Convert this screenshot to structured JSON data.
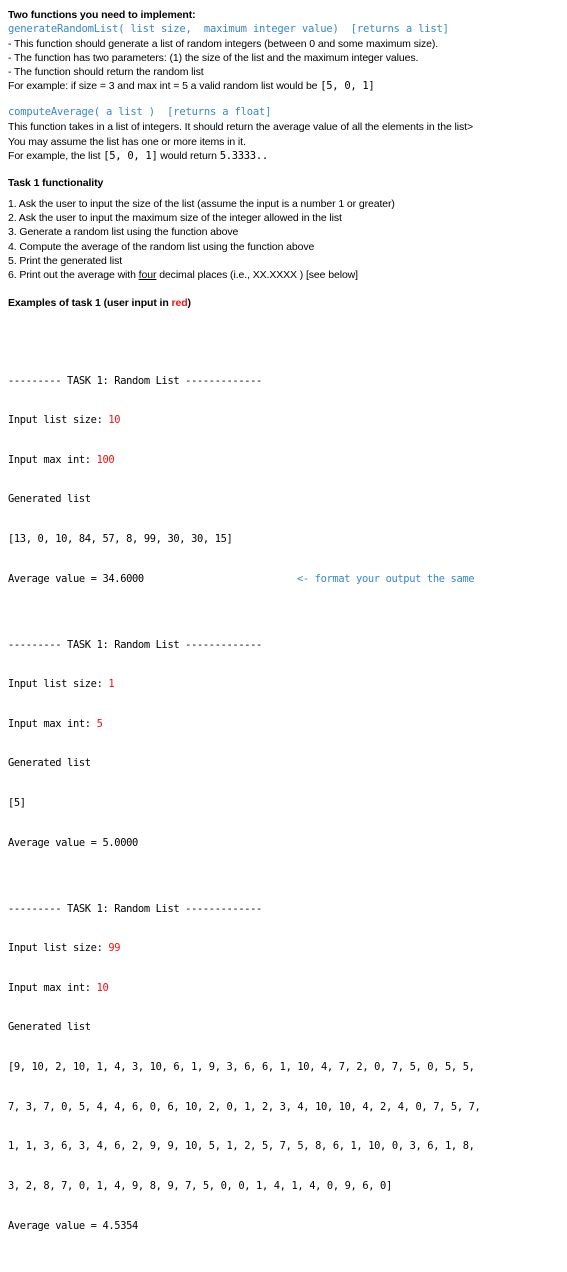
{
  "document": {
    "intro_heading": "Two functions you need to implement:",
    "functions": [
      {
        "signature": "generateRandomList( list size,  maximum integer value)  [returns a list]",
        "bullets": [
          "- This function should generate a list of random integers (between 0 and some maximum size).",
          "- The function has two parameters: (1) the size of the list and the maximum integer values.",
          "- The function should return the random list"
        ],
        "example_prefix": "For example: if size = 3 and max int = 5 a valid random list would be ",
        "example_mono": "[5, 0, 1]",
        "example_suffix": ""
      },
      {
        "signature": "computeAverage( a list )  [returns a float]",
        "bullets": [
          "This function takes in a list of integers.  It should return the average value of all the elements in the list>",
          "You may assume the list has one or more items in it."
        ],
        "example_prefix": "For example, the list ",
        "example_mono": "[5, 0, 1]",
        "example_suffix": " would return ",
        "example_mono2": "5.3333.."
      }
    ],
    "task_heading": "Task 1 functionality",
    "task_steps": [
      "1. Ask the user to input the size of the list (assume the input is a number 1 or greater)",
      "2. Ask the user to input the maximum size of the integer allowed in the list",
      "3. Generate a random list using the function above",
      "4. Compute the average of the random list using the function above",
      "5. Print the generated list"
    ],
    "task_step_6": {
      "before": "6. Print out the average with ",
      "underlined": "four",
      "after": " decimal places (i.e., XX.XXXX )  [see below]"
    },
    "examples_heading": {
      "before": "Examples of task 1 (user input in ",
      "red_word": "red",
      "after": ")"
    },
    "console": {
      "task_banner": "--------- TASK 1: Random List -------------",
      "prompt_size": "Input list size: ",
      "prompt_max": "Input max int: ",
      "generated_label": "Generated list",
      "average_label": "Average value = ",
      "side_note": "<- format your output the same",
      "runs": [
        {
          "input_size": "10",
          "input_max": "100",
          "list_lines": [
            "[13, 0, 10, 84, 57, 8, 99, 30, 30, 15]"
          ],
          "average": "34.6000",
          "has_note": true
        },
        {
          "input_size": "1",
          "input_max": "5",
          "list_lines": [
            "[5]"
          ],
          "average": "5.0000",
          "has_note": false
        },
        {
          "input_size": "99",
          "input_max": "10",
          "list_lines": [
            "[9, 10, 2, 10, 1, 4, 3, 10, 6, 1, 9, 3, 6, 6, 1, 10, 4, 7, 2, 0, 7, 5, 0, 5, 5,",
            "7, 3, 7, 0, 5, 4, 4, 6, 0, 6, 10, 2, 0, 1, 2, 3, 4, 10, 10, 4, 2, 4, 0, 7, 5, 7,",
            "1, 1, 3, 6, 3, 4, 6, 2, 9, 9, 10, 5, 1, 2, 5, 7, 5, 8, 6, 1, 10, 0, 3, 6, 1, 8,",
            "3, 2, 8, 7, 0, 1, 4, 9, 8, 9, 7, 5, 0, 0, 1, 4, 1, 4, 0, 9, 6, 0]"
          ],
          "average": "4.5354",
          "has_note": false
        }
      ]
    },
    "colors": {
      "code_blue": "#3a87c8",
      "input_red": "#ee1111",
      "text": "#000000",
      "background": "#ffffff"
    }
  }
}
